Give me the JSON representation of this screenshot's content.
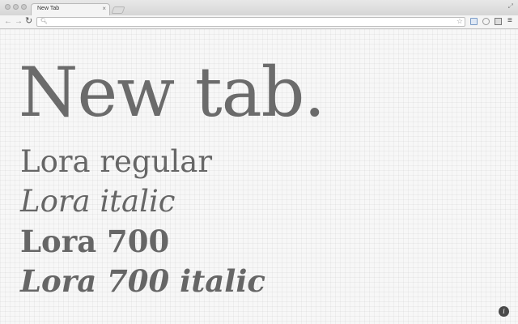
{
  "browser": {
    "tab": {
      "title": "New Tab",
      "close_glyph": "×"
    },
    "toolbar": {
      "back_glyph": "←",
      "forward_glyph": "→",
      "reload_glyph": "↻",
      "omnibox": {
        "value": "",
        "search_icon": "search-icon",
        "bookmark_icon": "star-icon"
      },
      "menu_glyph": "≡"
    },
    "fullscreen_glyph": "⤢"
  },
  "page": {
    "headline": "New tab.",
    "font_samples": [
      {
        "label": "Lora regular"
      },
      {
        "label": "Lora italic"
      },
      {
        "label": "Lora 700"
      },
      {
        "label": "Lora 700 italic"
      }
    ],
    "info_button_glyph": "i"
  },
  "colors": {
    "text": "#6b6b6b",
    "page_background": "#f7f7f7",
    "info_button": "#4a4a4a"
  }
}
